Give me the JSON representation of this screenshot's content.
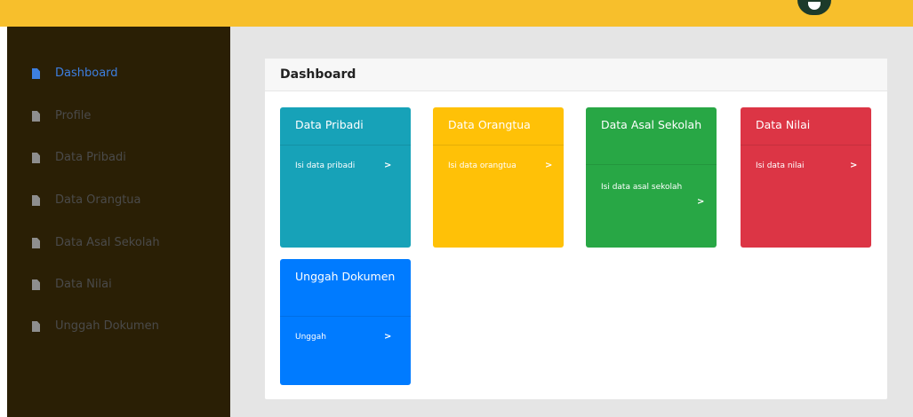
{
  "topbar": {
    "avatar_icon": "user-avatar-icon"
  },
  "sidebar": {
    "items": [
      {
        "label": "Dashboard",
        "icon": "file-icon",
        "active": true
      },
      {
        "label": "Profile",
        "icon": "file-icon"
      },
      {
        "label": "Data Pribadi",
        "icon": "file-icon"
      },
      {
        "label": "Data Orangtua",
        "icon": "file-icon"
      },
      {
        "label": "Data Asal Sekolah",
        "icon": "file-icon"
      },
      {
        "label": "Data Nilai",
        "icon": "file-icon"
      },
      {
        "label": "Unggah Dokumen",
        "icon": "file-icon"
      }
    ]
  },
  "main": {
    "title": "Dashboard",
    "cards": [
      {
        "title": "Data Pribadi",
        "link": "Isi data pribadi",
        "arrow": ">",
        "color": "#17a2b8"
      },
      {
        "title": "Data Orangtua",
        "link": "Isi data orangtua",
        "arrow": ">",
        "color": "#ffc107"
      },
      {
        "title": "Data Asal Sekolah",
        "link": "Isi data asal sekolah",
        "arrow": ">",
        "color": "#28a745"
      },
      {
        "title": "Data Nilai",
        "link": "Isi data nilai",
        "arrow": ">",
        "color": "#dc3545"
      },
      {
        "title": "Unggah Dokumen",
        "link": "Unggah",
        "arrow": ">",
        "color": "#007bff"
      }
    ]
  },
  "colors": {
    "topbar": "#f7bf2c",
    "sidebar": "#2a1f05",
    "active": "#3d7fe0"
  }
}
